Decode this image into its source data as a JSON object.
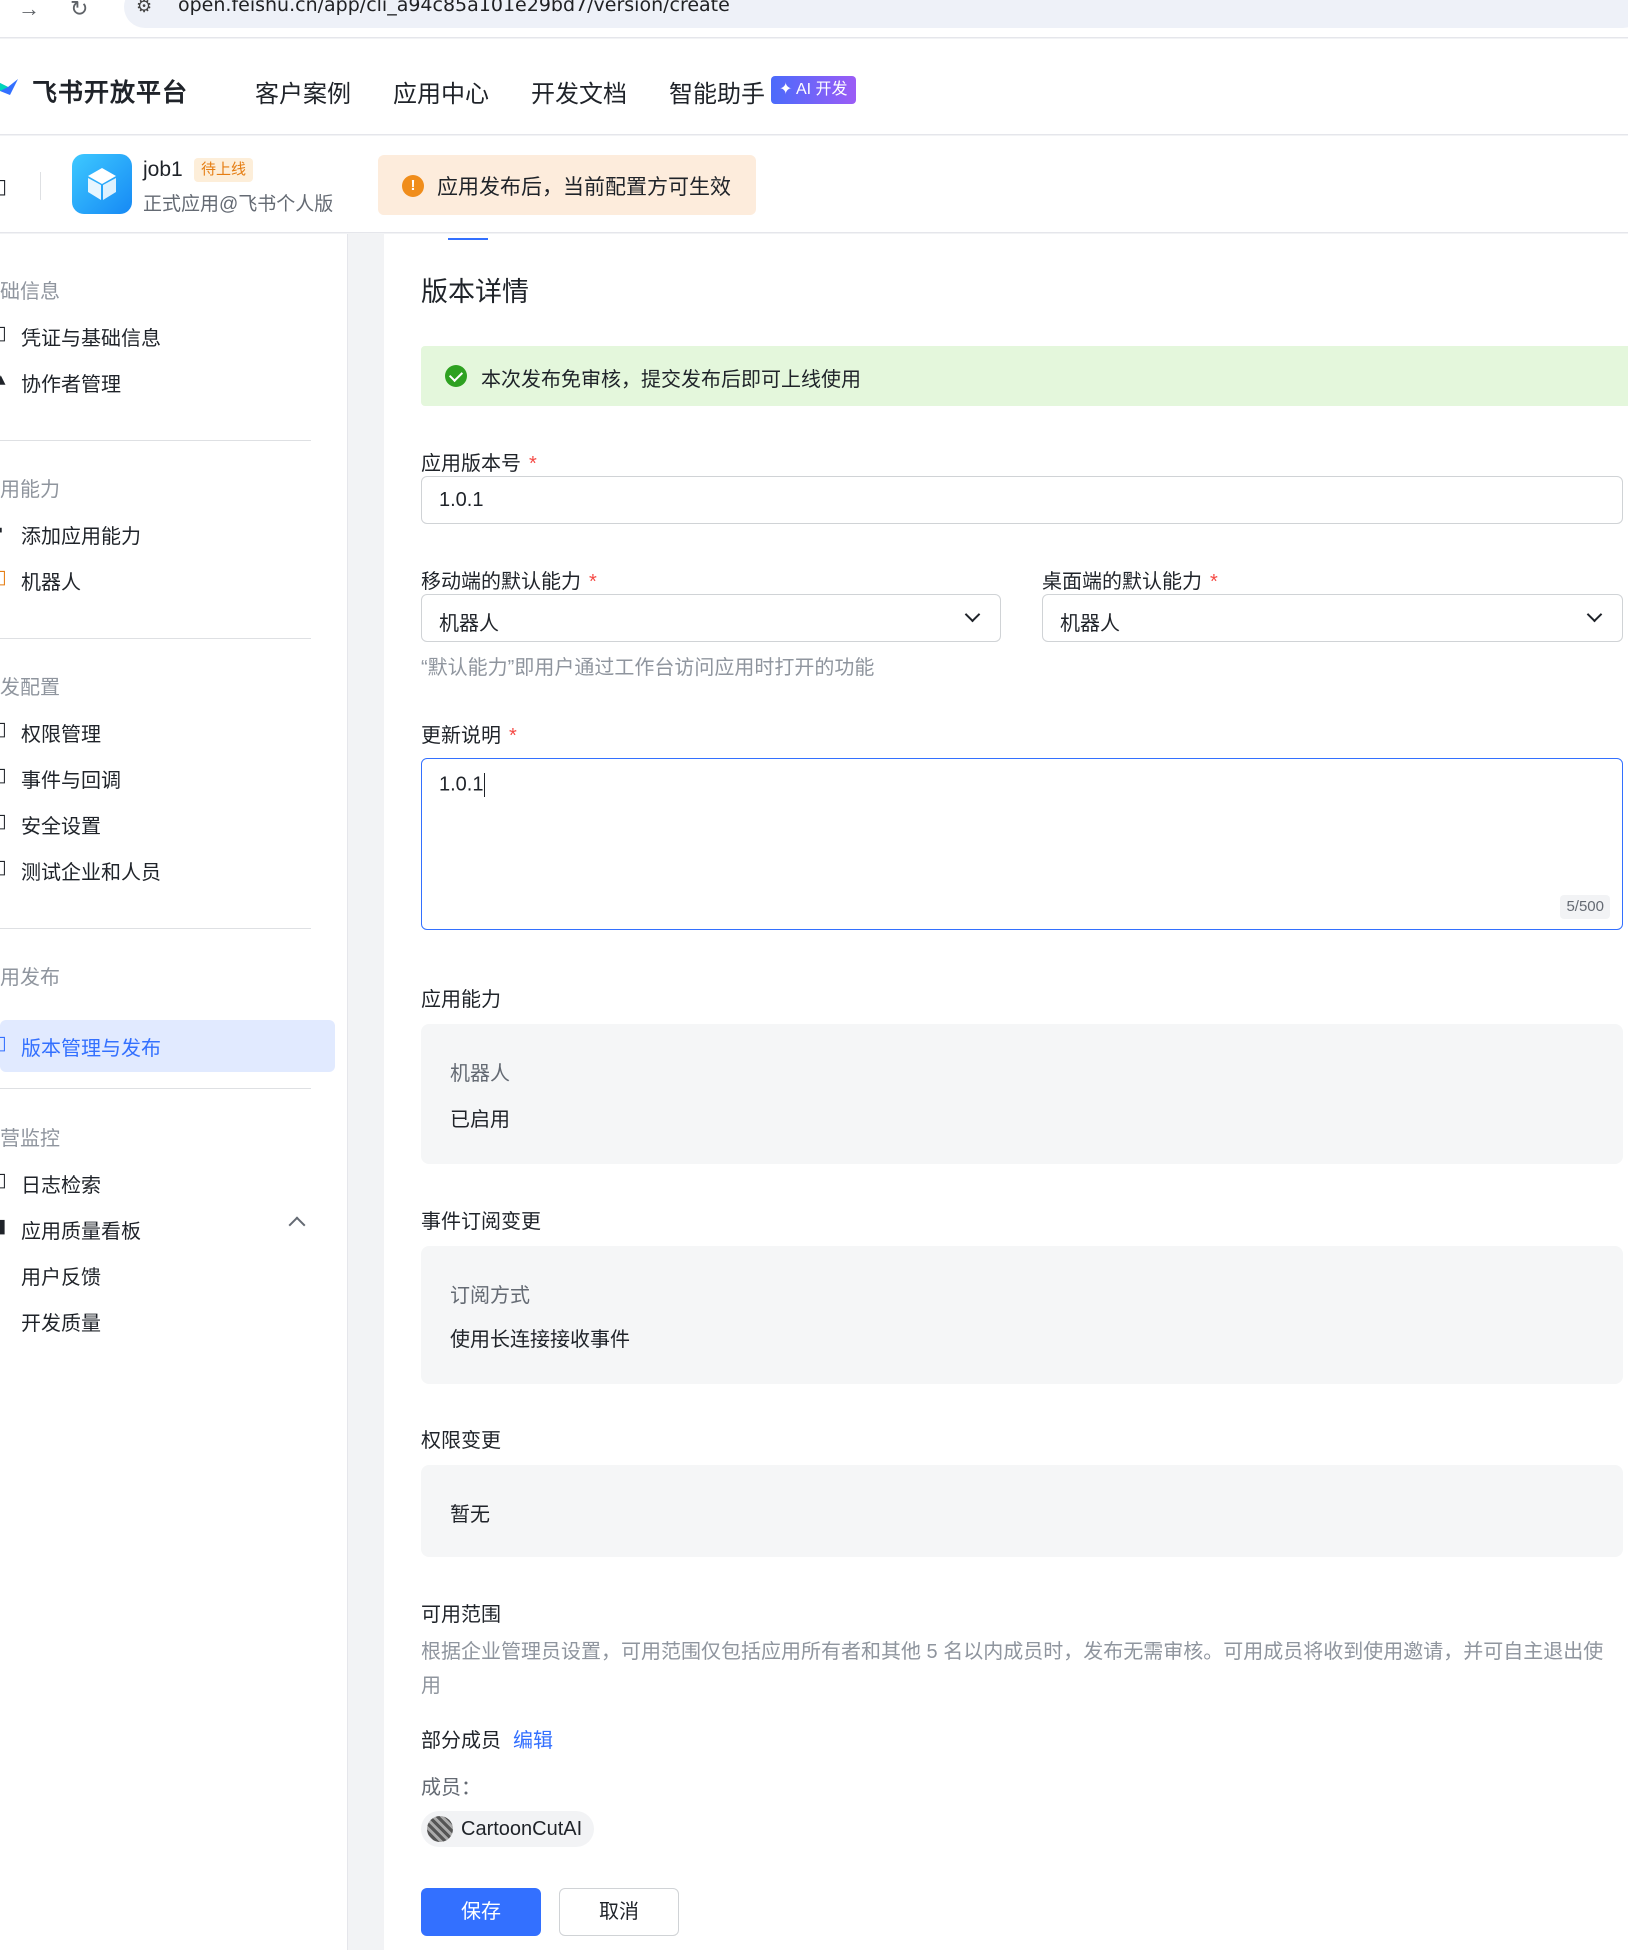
{
  "browser": {
    "url": "open.feishu.cn/app/cli_a94c85a101e29bd7/version/create"
  },
  "topnav": {
    "logo": "飞书开放平台",
    "items": [
      "客户案例",
      "应用中心",
      "开发文档",
      "智能助手"
    ],
    "ai_badge": "✦ AI 开发"
  },
  "app": {
    "name": "job1",
    "status": "待上线",
    "subtitle": "正式应用@飞书个人版",
    "notice": "应用发布后，当前配置方可生效"
  },
  "sidebar": {
    "groups": [
      {
        "title": "础信息",
        "items": [
          "凭证与基础信息",
          "协作者管理"
        ]
      },
      {
        "title": "用能力",
        "items": [
          "添加应用能力",
          "机器人"
        ]
      },
      {
        "title": "发配置",
        "items": [
          "权限管理",
          "事件与回调",
          "安全设置",
          "测试企业和人员"
        ]
      },
      {
        "title": "用发布",
        "items": [
          "版本管理与发布"
        ]
      },
      {
        "title": "营监控",
        "items": [
          "日志检索",
          "应用质量看板",
          "用户反馈",
          "开发质量"
        ]
      }
    ]
  },
  "main": {
    "title": "版本详情",
    "success_banner": "本次发布免审核，提交发布后即可上线使用",
    "version": {
      "label": "应用版本号",
      "value": "1.0.1"
    },
    "mobile_default": {
      "label": "移动端的默认能力",
      "value": "机器人"
    },
    "desktop_default": {
      "label": "桌面端的默认能力",
      "value": "机器人"
    },
    "default_hint": "“默认能力”即用户通过工作台访问应用时打开的功能",
    "changelog": {
      "label": "更新说明",
      "value": "1.0.1",
      "counter": "5/500"
    },
    "capabilities": {
      "label": "应用能力",
      "key": "机器人",
      "value": "已启用"
    },
    "events": {
      "label": "事件订阅变更",
      "key": "订阅方式",
      "value": "使用长连接接收事件"
    },
    "permissions": {
      "label": "权限变更",
      "value": "暂无"
    },
    "scope": {
      "label": "可用范围",
      "desc": "根据企业管理员设置，可用范围仅包括应用所有者和其他 5 名以内成员时，发布无需审核。可用成员将收到使用邀请，并可自主退出使用",
      "mode": "部分成员",
      "edit": "编辑",
      "members_label": "成员：",
      "member": "CartoonCutAI"
    },
    "save": "保存",
    "cancel": "取消"
  },
  "colors": {
    "primary": "#3370ff",
    "success_bg": "#e4f7dc",
    "warn_bg": "#fdecdc",
    "active_bg": "#e1eaff"
  }
}
